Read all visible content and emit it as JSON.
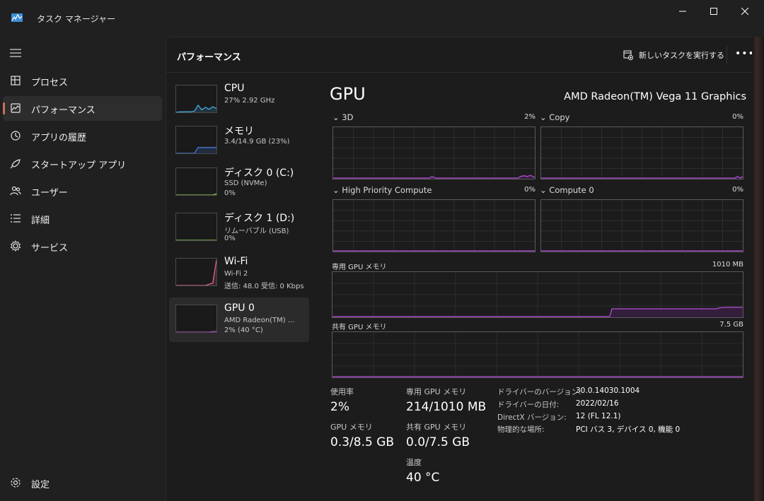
{
  "window": {
    "title": "タスク マネージャー"
  },
  "sidebar": {
    "items": [
      {
        "label": "プロセス",
        "icon": "processes-icon"
      },
      {
        "label": "パフォーマンス",
        "icon": "performance-icon",
        "active": true
      },
      {
        "label": "アプリの履歴",
        "icon": "history-icon"
      },
      {
        "label": "スタートアップ アプリ",
        "icon": "startup-icon"
      },
      {
        "label": "ユーザー",
        "icon": "users-icon"
      },
      {
        "label": "詳細",
        "icon": "details-icon"
      },
      {
        "label": "サービス",
        "icon": "services-icon"
      }
    ],
    "settings_label": "設定"
  },
  "header": {
    "title": "パフォーマンス",
    "new_task_label": "新しいタスクを実行する",
    "more_label": "•••"
  },
  "devices": [
    {
      "name": "CPU",
      "line1": "27%  2.92 GHz",
      "line2": "",
      "color": "#4ab0e8",
      "values": [
        0.0,
        0.02,
        0.02,
        0.03,
        0.02,
        0.05,
        0.28,
        0.1,
        0.2,
        0.12,
        0.22,
        0.15
      ]
    },
    {
      "name": "メモリ",
      "line1": "3.4/14.9 GB (23%)",
      "line2": "",
      "color": "#4a80e8",
      "values": [
        0.0,
        0.0,
        0.0,
        0.0,
        0.0,
        0.0,
        0.23,
        0.23,
        0.23,
        0.23,
        0.23,
        0.23
      ]
    },
    {
      "name": "ディスク 0 (C:)",
      "line1": "SSD (NVMe)",
      "line2": "0%",
      "color": "#8fd14f",
      "values": [
        0,
        0,
        0,
        0,
        0,
        0,
        0,
        0,
        0,
        0,
        0,
        0.05
      ]
    },
    {
      "name": "ディスク 1 (D:)",
      "line1": "リムーバブル (USB)",
      "line2": "0%",
      "color": "#8fd14f",
      "values": [
        0,
        0,
        0,
        0,
        0,
        0,
        0,
        0,
        0,
        0,
        0,
        0
      ]
    },
    {
      "name": "Wi-Fi",
      "line1": "Wi-Fi 2",
      "line2": "送信: 48.0 受信: 0 Kbps",
      "color": "#e86a9a",
      "values": [
        0,
        0,
        0,
        0,
        0,
        0,
        0,
        0,
        0,
        0.05,
        0.1,
        1.0
      ]
    },
    {
      "name": "GPU 0",
      "line1": "AMD Radeon(TM) ...",
      "line2": "2%  (40 °C)",
      "color": "#b44fd4",
      "values": [
        0,
        0,
        0,
        0,
        0,
        0,
        0,
        0,
        0,
        0,
        0.02,
        0.03
      ],
      "active": true
    }
  ],
  "gpu": {
    "title": "GPU",
    "model": "AMD Radeon(TM) Vega 11 Graphics",
    "engines": [
      {
        "name": "3D",
        "pct": "2%"
      },
      {
        "name": "Copy",
        "pct": "0%"
      },
      {
        "name": "High Priority Compute",
        "pct": "0%"
      },
      {
        "name": "Compute 0",
        "pct": "0%"
      }
    ],
    "dedicated_label": "専用 GPU メモリ",
    "dedicated_max": "1010 MB",
    "shared_label": "共有 GPU メモリ",
    "shared_max": "7.5 GB"
  },
  "chart_data": [
    {
      "type": "area",
      "title": "3D",
      "y_unit": "%",
      "ylim": [
        0,
        100
      ],
      "values": [
        0,
        0,
        0,
        0,
        0,
        0,
        0,
        0,
        0,
        0,
        0,
        0,
        0,
        0,
        0,
        0,
        0,
        0,
        0,
        0,
        0,
        0,
        0,
        0,
        0,
        0,
        0,
        0,
        0,
        0,
        0,
        0,
        0,
        0,
        0,
        0,
        0,
        0,
        0,
        0,
        0,
        0,
        0,
        0,
        0,
        0,
        0,
        0,
        0,
        0,
        0,
        0,
        0,
        0,
        0,
        0,
        0,
        0,
        0,
        0,
        0,
        0,
        0,
        0,
        0,
        0,
        0,
        0,
        0,
        0,
        0,
        0,
        0,
        0,
        0,
        0,
        2,
        3,
        2,
        1,
        0,
        0,
        0,
        0,
        0,
        0,
        0,
        0,
        0,
        0,
        0,
        0,
        0,
        0,
        0,
        0,
        0,
        0,
        0,
        0,
        0,
        0,
        0,
        0,
        0,
        0,
        0,
        0,
        0,
        0,
        0,
        0,
        0,
        0,
        0,
        0,
        0,
        0,
        0,
        0,
        0,
        0,
        0,
        0,
        0,
        0,
        0,
        0,
        0,
        0,
        0,
        0,
        0,
        0,
        0,
        0,
        0,
        0,
        0,
        0,
        0,
        0,
        0,
        0,
        0,
        2,
        3,
        4,
        4,
        5,
        4,
        3,
        4,
        5,
        5,
        4,
        2,
        2
      ]
    },
    {
      "type": "area",
      "title": "Copy",
      "y_unit": "%",
      "ylim": [
        0,
        100
      ],
      "values": [
        0,
        0,
        0,
        0,
        0,
        0,
        0,
        0,
        0,
        0,
        0,
        0,
        0,
        0,
        0,
        0,
        0,
        0,
        0,
        0,
        0,
        0,
        0,
        0,
        0,
        0,
        0,
        0,
        0,
        0,
        0,
        0,
        0,
        0,
        0,
        0,
        0,
        0,
        0,
        0,
        0,
        0,
        0,
        0,
        0,
        0,
        0,
        0,
        0,
        0,
        0,
        0,
        0,
        0,
        0,
        0,
        0,
        0,
        0,
        0,
        0,
        0,
        0,
        0,
        0,
        0,
        0,
        0,
        0,
        0,
        0,
        0,
        0,
        0,
        0,
        0,
        0,
        0,
        0,
        0,
        0,
        0,
        0,
        0,
        0,
        0,
        0,
        0,
        0,
        0,
        0,
        0,
        0,
        0,
        0,
        0,
        0,
        0,
        0,
        0,
        0,
        0,
        0,
        0,
        0,
        0,
        0,
        0,
        0,
        0,
        0,
        0,
        0,
        0,
        0,
        0,
        0,
        0,
        0,
        0,
        0,
        0,
        0,
        0,
        0,
        0,
        0,
        0,
        0,
        0,
        0,
        0,
        0,
        0,
        0,
        0,
        0,
        0,
        0,
        0,
        0,
        0,
        0,
        0,
        0,
        0,
        0,
        0,
        0,
        0,
        0,
        0,
        2,
        3,
        2,
        0,
        2,
        2
      ]
    },
    {
      "type": "area",
      "title": "High Priority Compute",
      "y_unit": "%",
      "ylim": [
        0,
        100
      ],
      "values": [
        0,
        0
      ]
    },
    {
      "type": "area",
      "title": "Compute 0",
      "y_unit": "%",
      "ylim": [
        0,
        100
      ],
      "values": [
        0,
        0
      ]
    },
    {
      "type": "area",
      "title": "専用 GPU メモリ",
      "y_unit": "MB",
      "ylim": [
        0,
        1010
      ],
      "values": [
        0,
        0,
        0,
        0,
        0,
        0,
        0,
        0,
        0,
        0,
        0,
        0,
        0,
        0,
        0,
        0,
        0,
        0,
        0,
        0,
        0,
        0,
        0,
        0,
        0,
        0,
        0,
        0,
        0,
        0,
        0,
        0,
        0,
        0,
        0,
        0,
        0,
        0,
        0,
        0,
        0,
        0,
        0,
        0,
        0,
        0,
        0,
        0,
        0,
        0,
        0,
        0,
        0,
        0,
        0,
        0,
        0,
        0,
        0,
        0,
        0,
        0,
        0,
        0,
        0,
        0,
        0,
        0,
        0,
        0,
        0,
        0,
        0,
        0,
        0,
        0,
        0,
        0,
        0,
        0,
        0,
        0,
        0,
        0,
        0,
        0,
        0,
        0,
        0,
        0,
        0,
        0,
        0,
        0,
        0,
        0,
        0,
        0,
        0,
        0,
        0,
        0,
        0,
        0,
        0,
        0,
        0,
        0,
        0,
        0,
        0,
        0,
        0,
        0,
        0,
        0,
        0,
        0,
        0,
        0,
        0,
        0,
        0,
        0,
        0,
        0,
        180,
        180,
        180,
        180,
        180,
        180,
        180,
        180,
        180,
        180,
        180,
        180,
        180,
        180,
        180,
        180,
        180,
        180,
        180,
        180,
        180,
        180,
        180,
        180,
        180,
        180,
        180,
        180,
        180,
        180,
        180,
        180,
        180,
        180,
        180,
        180,
        180,
        180,
        180,
        180,
        180,
        180,
        180,
        180,
        180,
        180,
        180,
        180,
        195,
        205,
        210,
        212,
        214,
        214,
        214,
        214,
        214,
        214,
        214,
        214
      ]
    },
    {
      "type": "area",
      "title": "共有 GPU メモリ",
      "y_unit": "GB",
      "ylim": [
        0,
        7.5
      ],
      "values": [
        0,
        0
      ]
    }
  ],
  "stats": {
    "usage_label": "使用率",
    "usage_value": "2%",
    "dedicated_label": "専用 GPU メモリ",
    "dedicated_value": "214/1010 MB",
    "gpumem_label": "GPU メモリ",
    "gpumem_value": "0.3/8.5 GB",
    "shared_label": "共有 GPU メモリ",
    "shared_value": "0.0/7.5 GB",
    "temp_label": "温度",
    "temp_value": "40 °C"
  },
  "info": [
    {
      "label": "ドライバーのバージョン:",
      "value": "30.0.14030.1004"
    },
    {
      "label": "ドライバーの日付:",
      "value": "2022/02/16"
    },
    {
      "label": "DirectX バージョン:",
      "value": "12 (FL 12.1)"
    },
    {
      "label": "物理的な場所:",
      "value": "PCI バス 3, デバイス 0, 機能 0"
    }
  ],
  "colors": {
    "gpu_line": "#b44fd4",
    "gpu_fill": "#3a1f45",
    "grid": "#3a3a3a",
    "accent": "#c9715a"
  }
}
